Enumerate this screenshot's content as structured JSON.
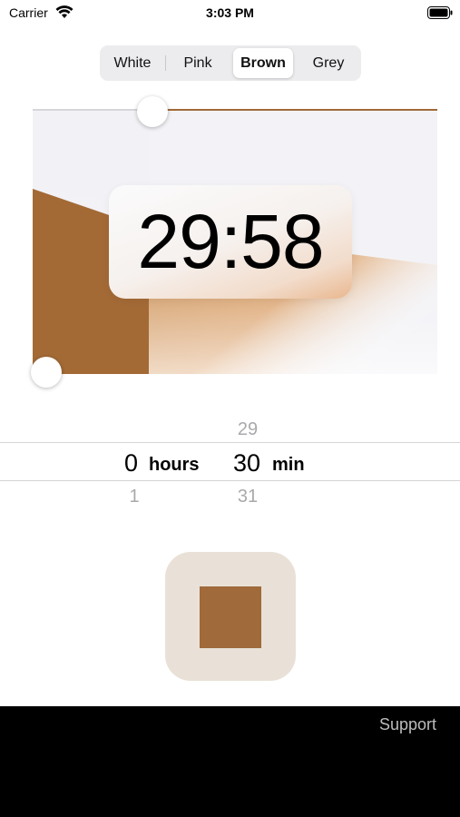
{
  "status_bar": {
    "carrier": "Carrier",
    "time": "3:03 PM",
    "wifi_icon": "wifi-icon",
    "battery_icon": "battery-icon"
  },
  "segmented_control": {
    "options": [
      "White",
      "Pink",
      "Brown",
      "Grey"
    ],
    "selected": "Brown"
  },
  "timer": {
    "remaining": "29:58"
  },
  "picker": {
    "hours": {
      "above": "",
      "selected": "0",
      "below": "1",
      "unit": "hours"
    },
    "minutes": {
      "above": "29",
      "selected": "30",
      "below": "31",
      "unit": "min"
    }
  },
  "stop_button": {
    "icon": "stop-icon"
  },
  "footer": {
    "support_label": "Support"
  },
  "colors": {
    "accent_brown": "#a06a3a",
    "stop_bg": "#e9e1d7",
    "footer_bg": "#000000",
    "support_text": "#bdbdbd"
  }
}
